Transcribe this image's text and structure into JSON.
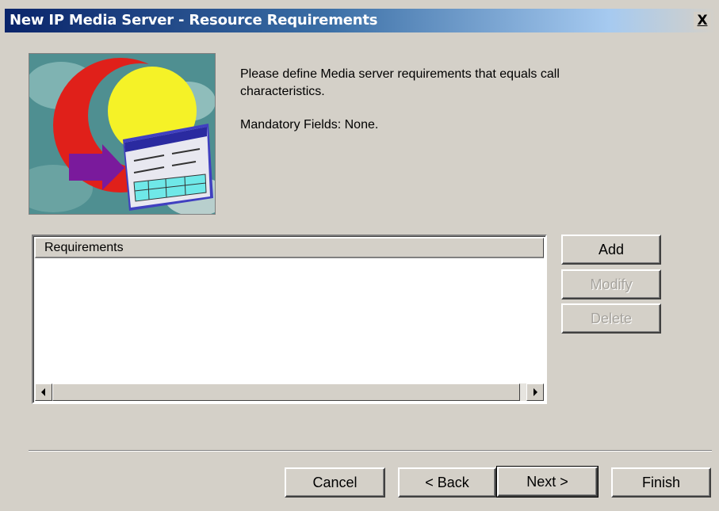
{
  "window": {
    "title": "New IP Media Server - Resource Requirements",
    "close_glyph": "X"
  },
  "header": {
    "intro_text": "Please define Media server requirements that equals call characteristics.",
    "mandatory_text": "Mandatory Fields: None."
  },
  "requirements_list": {
    "column_header": "Requirements",
    "rows": []
  },
  "side_buttons": {
    "add": {
      "label": "Add",
      "enabled": true
    },
    "modify": {
      "label": "Modify",
      "enabled": false
    },
    "delete": {
      "label": "Delete",
      "enabled": false
    }
  },
  "footer_buttons": {
    "cancel": "Cancel",
    "back": "< Back",
    "next": "Next >",
    "finish": "Finish"
  },
  "icons": {
    "wizard_image": "wizard-illustration",
    "scroll_left": "triangle-left-icon",
    "scroll_right": "triangle-right-icon"
  },
  "colors": {
    "dialog_bg": "#d4d0c8",
    "titlebar_start": "#0a246a",
    "titlebar_end": "#a6caf0"
  }
}
